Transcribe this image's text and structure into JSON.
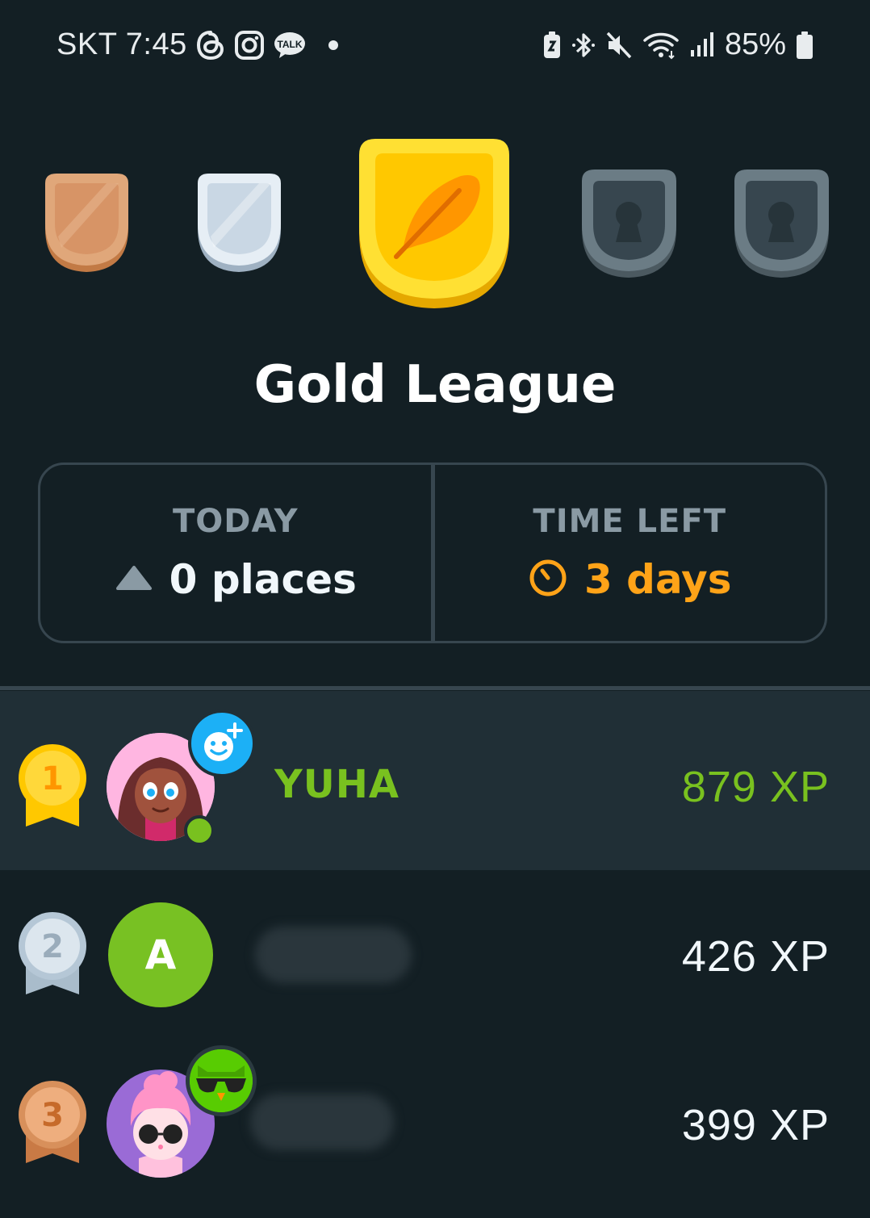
{
  "status_bar": {
    "carrier_time": "SKT 7:45",
    "battery": "85%",
    "icons_left": [
      "threads-icon",
      "instagram-icon",
      "kakaotalk-icon",
      "notification-dot"
    ],
    "talk_label": "TALK",
    "icons_right": [
      "battery-saver-icon",
      "bluetooth-icon",
      "mute-icon",
      "wifi-icon",
      "signal-icon",
      "battery-icon"
    ]
  },
  "league": {
    "title": "Gold League",
    "badges": [
      {
        "name": "bronze",
        "state": "completed",
        "color": "#cd8f5e"
      },
      {
        "name": "silver",
        "state": "completed",
        "color": "#c3d2df"
      },
      {
        "name": "gold",
        "state": "current",
        "color": "#ffc800"
      },
      {
        "name": "locked-4",
        "state": "locked",
        "color": "#55636b"
      },
      {
        "name": "locked-5",
        "state": "locked",
        "color": "#55636b"
      }
    ]
  },
  "stats": {
    "today_label": "TODAY",
    "today_value": "0 places",
    "time_left_label": "TIME LEFT",
    "time_left_value": "3 days"
  },
  "leaderboard": [
    {
      "rank": "1",
      "name": "YUHA",
      "xp": "879 XP",
      "is_me": true,
      "medal_color": "#ffc800",
      "online": true
    },
    {
      "rank": "2",
      "name": "",
      "xp": "426 XP",
      "is_me": false,
      "medal_color": "#b5c7d6",
      "avatar_letter": "A"
    },
    {
      "rank": "3",
      "name": "",
      "xp": "399 XP",
      "is_me": false,
      "medal_color": "#d8905b"
    }
  ],
  "colors": {
    "background": "#131f24",
    "highlight_row": "#202f36",
    "accent_green": "#79c11f",
    "accent_orange": "#ffa318",
    "border": "#37464f"
  }
}
